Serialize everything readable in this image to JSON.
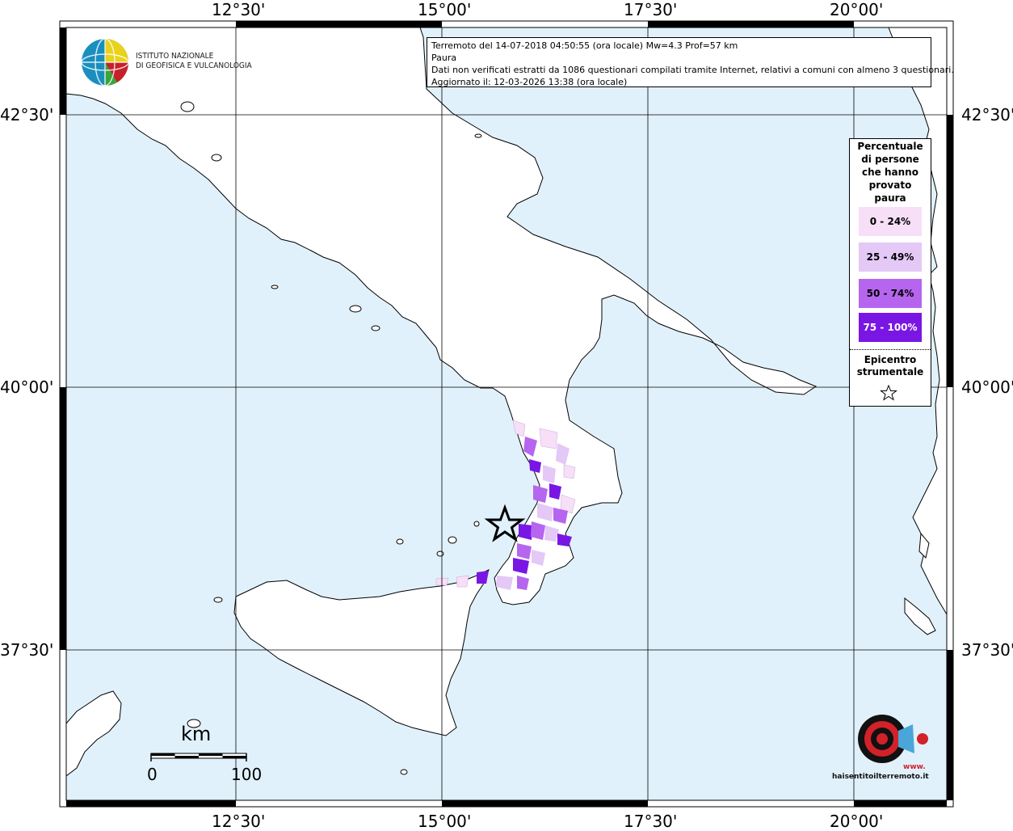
{
  "header": {
    "line1": "Terremoto del 14-07-2018 04:50:55 (ora locale) Mw=4.3 Prof=57 km",
    "line2": "Paura",
    "line3": "Dati non verificati estratti da 1086 questionari compilati tramite Internet, relativi a comuni con almeno 3 questionari.",
    "line4": "Aggiornato il: 12-03-2026 13:38 (ora locale)"
  },
  "logo": {
    "line1": "ISTITUTO NAZIONALE",
    "line2": "DI GEOFISICA E VULCANOLOGIA"
  },
  "axes": {
    "top": [
      "12°30'",
      "15°00'",
      "17°30'",
      "20°00'"
    ],
    "bottom": [
      "12°30'",
      "15°00'",
      "17°30'",
      "20°00'"
    ],
    "left": [
      "42°30'",
      "40°00'",
      "37°30'"
    ],
    "right": [
      "42°30'",
      "40°00'",
      "37°30'"
    ]
  },
  "legend": {
    "title_lines": [
      "Percentuale",
      "di persone",
      "che hanno",
      "provato",
      "paura"
    ],
    "classes": [
      {
        "label": "0 - 24%",
        "color": "#f7dff8"
      },
      {
        "label": "25 - 49%",
        "color": "#e4c8f6"
      },
      {
        "label": "50 - 74%",
        "color": "#b666ee"
      },
      {
        "label": "75 - 100%",
        "color": "#7a16e4"
      }
    ],
    "epicenter_line1": "Epicentro",
    "epicenter_line2": "strumentale"
  },
  "scale": {
    "unit": "km",
    "min": "0",
    "max": "100"
  },
  "badge": {
    "text": "haisentitoilterremoto.it",
    "url": "www."
  },
  "colors": {
    "sea": "#e1f1fb",
    "land": "#ffffff"
  }
}
